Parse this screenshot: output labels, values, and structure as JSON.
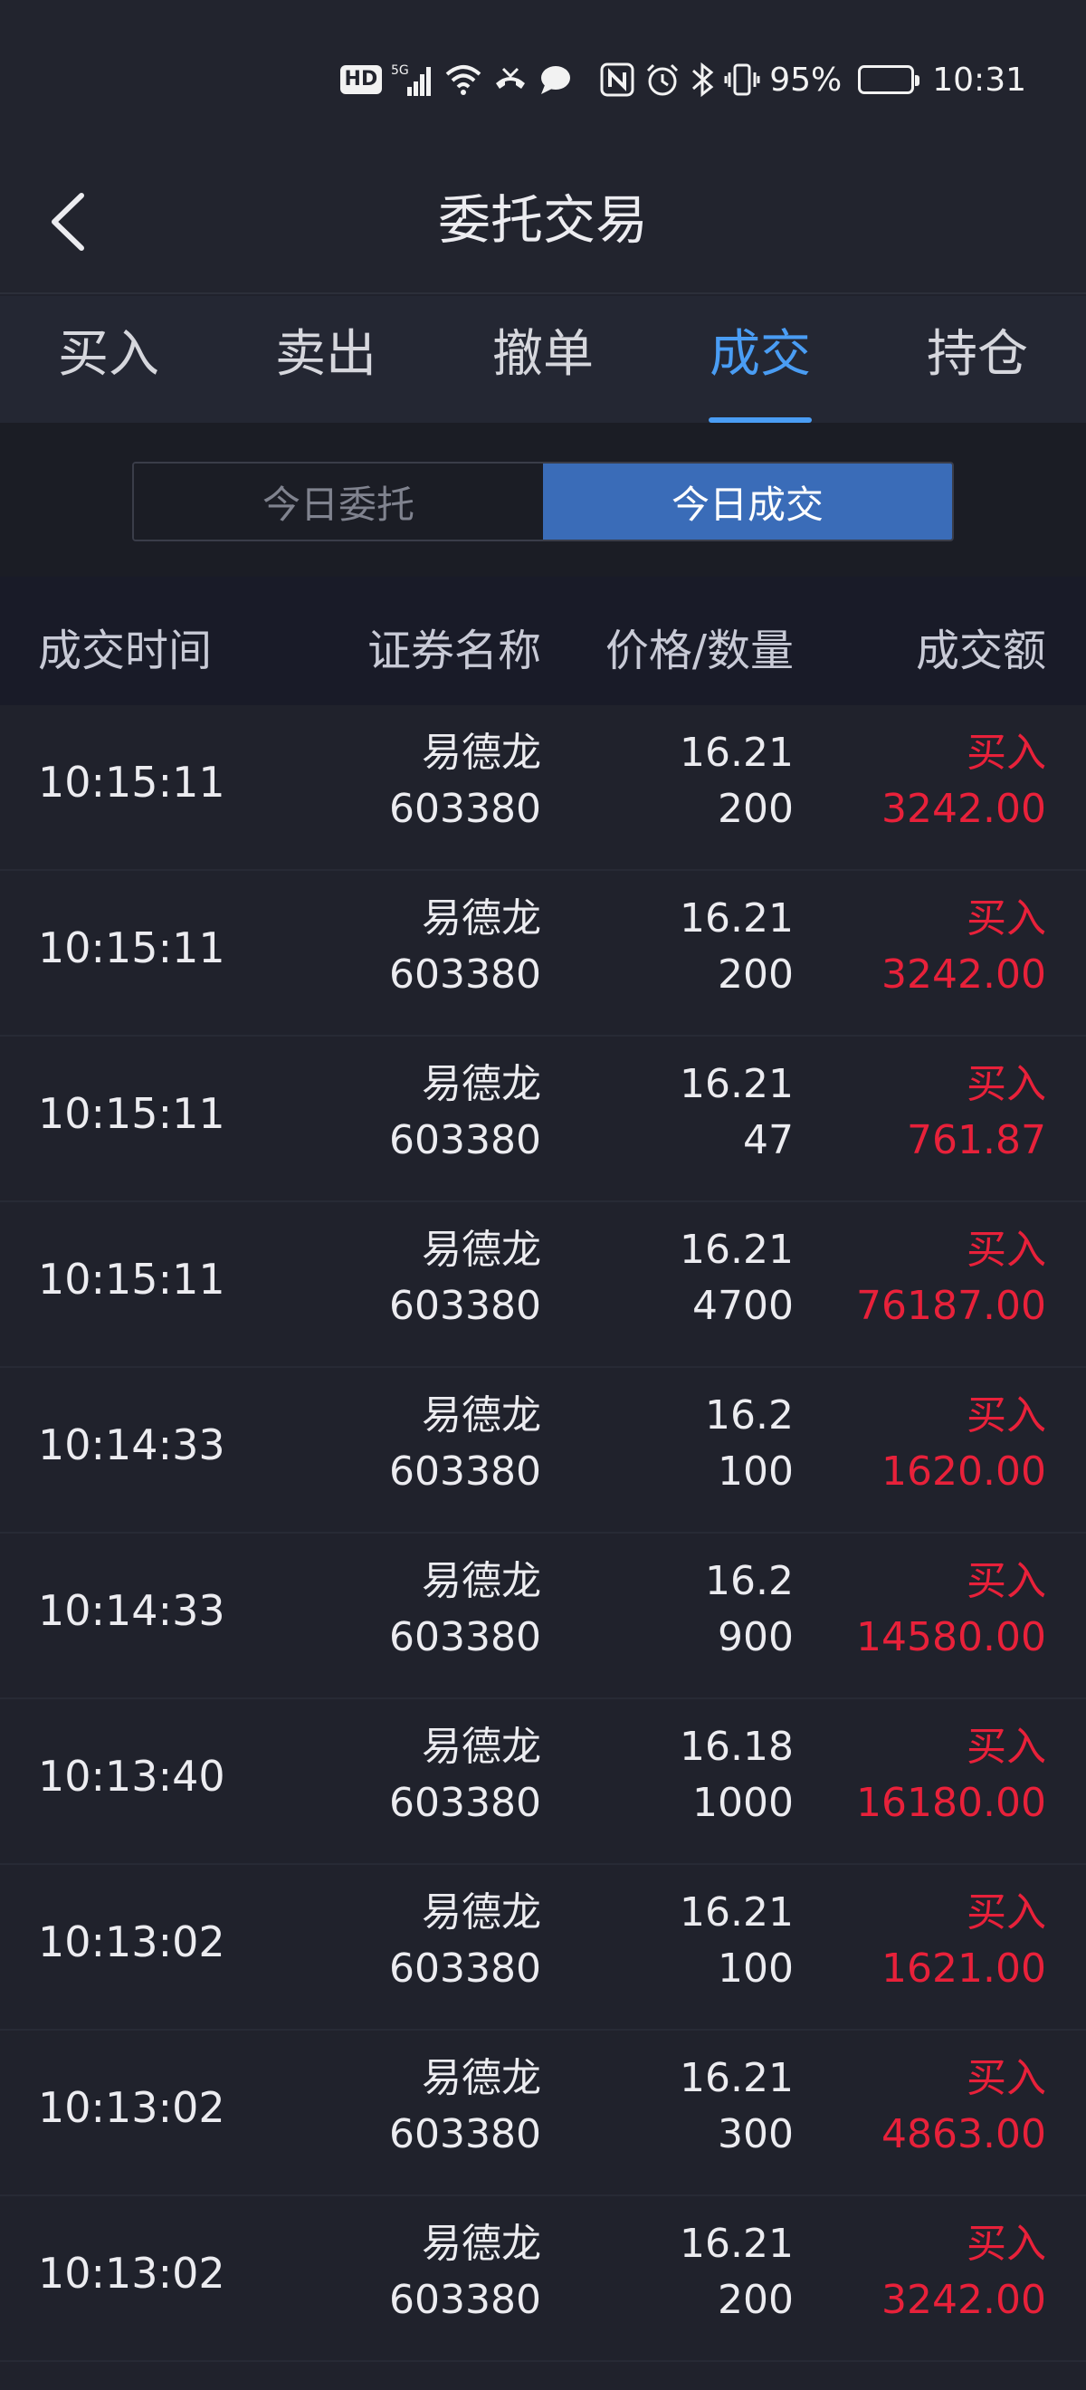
{
  "status_bar": {
    "hd": "HD",
    "signal": "5G",
    "battery_percent": "95%",
    "battery_level": 0.95,
    "time": "10:31",
    "icons": [
      "hd-icon",
      "signal-5g-icon",
      "wifi-icon",
      "call-icon",
      "chat-bubble-icon",
      "nfc-icon",
      "alarm-icon",
      "bluetooth-icon",
      "vibrate-icon",
      "battery-icon"
    ]
  },
  "header": {
    "title": "委托交易",
    "back_icon": "chevron-left-icon"
  },
  "tabs": [
    {
      "label": "买入",
      "active": false
    },
    {
      "label": "卖出",
      "active": false
    },
    {
      "label": "撤单",
      "active": false
    },
    {
      "label": "成交",
      "active": true
    },
    {
      "label": "持仓",
      "active": false
    }
  ],
  "segment": {
    "options": [
      "今日委托",
      "今日成交"
    ],
    "selected": "今日成交"
  },
  "table": {
    "headers": {
      "time": "成交时间",
      "name": "证券名称",
      "price_qty": "价格/数量",
      "amount": "成交额"
    },
    "rows": [
      {
        "time": "10:15:11",
        "name": "易德龙",
        "code": "603380",
        "price": "16.21",
        "qty": "200",
        "side": "买入",
        "amount": "3242.00"
      },
      {
        "time": "10:15:11",
        "name": "易德龙",
        "code": "603380",
        "price": "16.21",
        "qty": "200",
        "side": "买入",
        "amount": "3242.00"
      },
      {
        "time": "10:15:11",
        "name": "易德龙",
        "code": "603380",
        "price": "16.21",
        "qty": "47",
        "side": "买入",
        "amount": "761.87"
      },
      {
        "time": "10:15:11",
        "name": "易德龙",
        "code": "603380",
        "price": "16.21",
        "qty": "4700",
        "side": "买入",
        "amount": "76187.00"
      },
      {
        "time": "10:14:33",
        "name": "易德龙",
        "code": "603380",
        "price": "16.2",
        "qty": "100",
        "side": "买入",
        "amount": "1620.00"
      },
      {
        "time": "10:14:33",
        "name": "易德龙",
        "code": "603380",
        "price": "16.2",
        "qty": "900",
        "side": "买入",
        "amount": "14580.00"
      },
      {
        "time": "10:13:40",
        "name": "易德龙",
        "code": "603380",
        "price": "16.18",
        "qty": "1000",
        "side": "买入",
        "amount": "16180.00"
      },
      {
        "time": "10:13:02",
        "name": "易德龙",
        "code": "603380",
        "price": "16.21",
        "qty": "100",
        "side": "买入",
        "amount": "1621.00"
      },
      {
        "time": "10:13:02",
        "name": "易德龙",
        "code": "603380",
        "price": "16.21",
        "qty": "300",
        "side": "买入",
        "amount": "4863.00"
      },
      {
        "time": "10:13:02",
        "name": "易德龙",
        "code": "603380",
        "price": "16.21",
        "qty": "200",
        "side": "买入",
        "amount": "3242.00"
      }
    ]
  },
  "colors": {
    "background": "#20222c",
    "accent": "#4a9df4",
    "segment_active": "#3a6cb8",
    "buy_red": "#e8213a"
  }
}
